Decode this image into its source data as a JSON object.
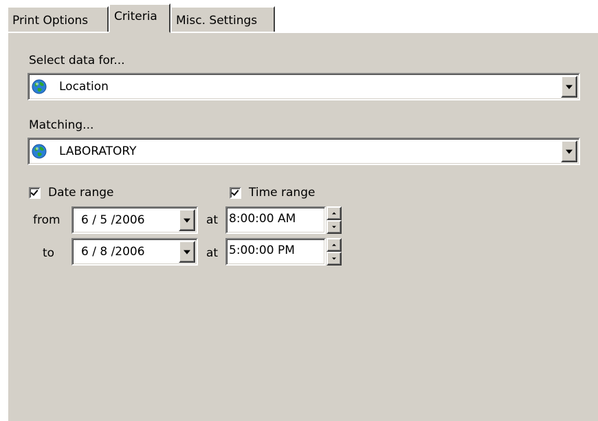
{
  "tabs": [
    {
      "label": "Print Options",
      "active": false
    },
    {
      "label": "Criteria",
      "active": true
    },
    {
      "label": "Misc. Settings",
      "active": false
    }
  ],
  "criteria": {
    "select_label": "Select data for...",
    "select_value": "Location",
    "select_icon": "globe-icon",
    "matching_label": "Matching...",
    "matching_value": "LABORATORY",
    "matching_icon": "globe-icon",
    "date_range": {
      "label": "Date range",
      "checked": true
    },
    "time_range": {
      "label": "Time range",
      "checked": true
    },
    "from_label": "from",
    "to_label": "to",
    "at_label": "at",
    "from_date": "6 / 5 /2006",
    "to_date": "6 / 8 /2006",
    "from_time": "8:00:00 AM",
    "to_time": "5:00:00 PM"
  },
  "colors": {
    "face": "#d4d0c8",
    "highlight": "#ffffff",
    "shadow": "#808080",
    "dark_shadow": "#404040",
    "window": "#ffffff"
  }
}
